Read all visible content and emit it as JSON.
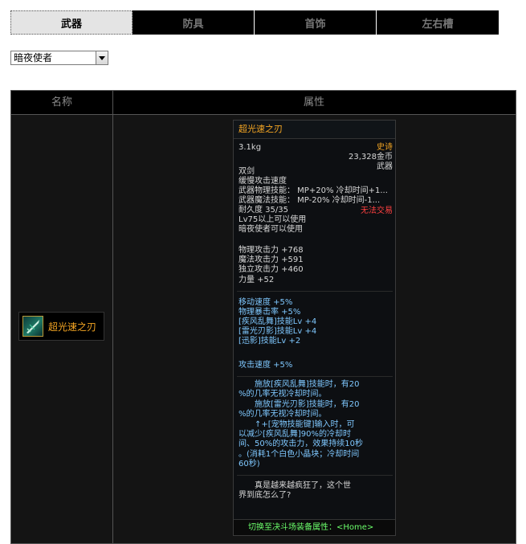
{
  "tabs": [
    "武器",
    "防具",
    "首饰",
    "左右槽"
  ],
  "active_tab": 0,
  "class_select": {
    "value": "暗夜使者"
  },
  "table": {
    "headers": {
      "name": "名称",
      "attributes": "属性"
    }
  },
  "item": {
    "name": "超光速之刃",
    "icon": "sword-icon",
    "tooltip": {
      "title": "超光速之刃",
      "weight": "3.1kg",
      "rarity": "史诗",
      "price": "23,328金币",
      "category": "武器",
      "type": "双剑",
      "attack_speed": "缓慢攻击速度",
      "phys_skill": "武器物理技能： MP+20% 冷却时间+1...",
      "magic_skill": "武器魔法技能： MP-20% 冷却时间-1...",
      "durability": "耐久度 35/35",
      "trade": "无法交易",
      "level_req": "Lv75以上可以使用",
      "class_req": "暗夜使者可以使用",
      "stats": [
        "物理攻击力 +768",
        "魔法攻击力 +591",
        "独立攻击力 +460",
        "力量 +52"
      ],
      "bonuses": [
        "移动速度 +5%",
        "物理暴击率 +5%",
        "[疾风乱舞]技能Lv +4",
        "[雷光刃影]技能Lv +4",
        "[迅影]技能Lv +2"
      ],
      "attack_speed_bonus": "攻击速度 +5%",
      "effects": [
        "施放[疾风乱舞]技能时，有20",
        "%的几率无视冷却时间。",
        "施放[雷光刃影]技能时，有20",
        "%的几率无视冷却时间。",
        "↑+[宠物技能键]输入时，可",
        "以减少[疾风乱舞]90%的冷却时",
        "间、50%的攻击力，效果持续10秒",
        "。(消耗1个白色小晶块；冷却时间",
        "60秒)"
      ],
      "flavor": [
        "真是越来越疯狂了，这个世",
        "界到底怎么了?"
      ],
      "footer": "切换至决斗场装备属性：<Home>"
    }
  },
  "colors": {
    "rarity": "#f5a623",
    "bonus": "#7fc8ff",
    "warning": "#ff4040",
    "footer": "#6cff6c"
  }
}
